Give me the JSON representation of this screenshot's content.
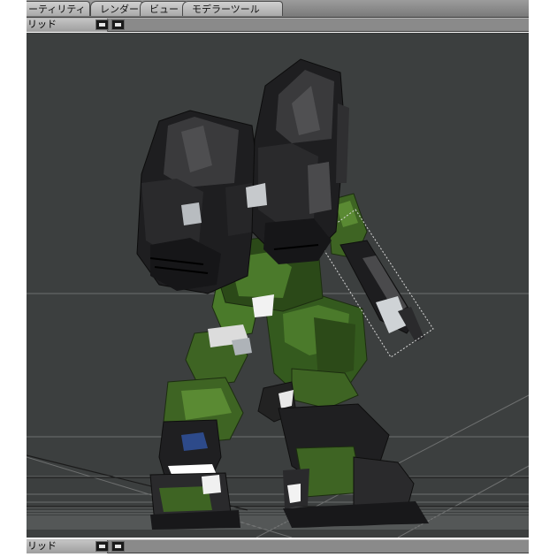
{
  "tabs": [
    {
      "label": "ーティリティ"
    },
    {
      "label": "レンダー"
    },
    {
      "label": "ビュー"
    },
    {
      "label": "モデラーツール"
    }
  ],
  "viewport_top": {
    "view_mode": "リッド",
    "button_icon": "minus-icon"
  },
  "viewport_bottom": {
    "view_mode": "リッド",
    "button_icon": "minus-icon"
  },
  "colors": {
    "viewport_bg": "#3c3f3f",
    "armor_green": "#3e6423",
    "armor_black": "#1e1e20",
    "selection_outline": "#d8d8d8"
  }
}
